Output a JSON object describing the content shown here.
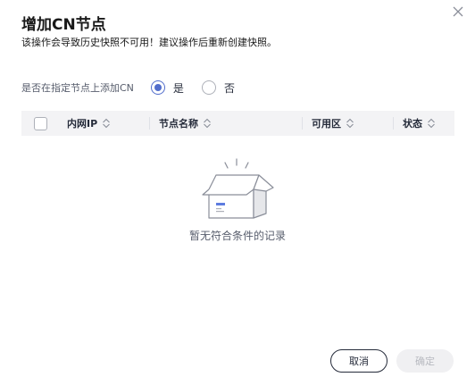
{
  "dialog": {
    "title": "增加CN节点",
    "subtitle": "该操作会导致历史快照不可用！建议操作后重新创建快照。",
    "close_icon": "close-icon"
  },
  "form": {
    "label": "是否在指定节点上添加CN",
    "options": [
      {
        "label": "是",
        "checked": true
      },
      {
        "label": "否",
        "checked": false
      }
    ]
  },
  "table": {
    "columns": [
      {
        "label": "内网IP",
        "sortable": true
      },
      {
        "label": "节点名称",
        "sortable": true
      },
      {
        "label": "可用区",
        "sortable": true
      },
      {
        "label": "状态",
        "sortable": true
      }
    ],
    "rows": []
  },
  "empty": {
    "text": "暂无符合条件的记录",
    "icon": "empty-box-icon"
  },
  "buttons": {
    "cancel": "取消",
    "ok": "确定"
  },
  "colors": {
    "accent": "#526ecc",
    "header_bg": "#f3f3f5",
    "disabled_bg": "#f0f0f2",
    "disabled_text": "#b8bac0"
  }
}
